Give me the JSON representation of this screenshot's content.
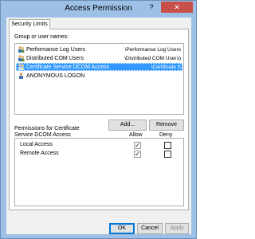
{
  "window": {
    "title": "Access Permission",
    "help_glyph": "?",
    "close_glyph": "✕"
  },
  "tabs": [
    {
      "label": "Security Limits"
    }
  ],
  "group_label": "Group or user names:",
  "users": [
    {
      "name": "Performance Log Users",
      "path": "\\Performance Log Users",
      "selected": false
    },
    {
      "name": "Distributed COM Users",
      "path": "\\Distributed COM Users)",
      "selected": false
    },
    {
      "name": "Certificate Service DCOM Access",
      "path": "\\Certificate S",
      "selected": true
    },
    {
      "name": "ANONYMOUS LOGON",
      "path": "",
      "selected": false
    }
  ],
  "buttons": {
    "add": "Add...",
    "remove": "Remove",
    "ok": "OK",
    "cancel": "Cancel",
    "apply": "Apply"
  },
  "permissions": {
    "header_line1": "Permissions for Certificate",
    "header_line2": "Service DCOM Access",
    "allow_label": "Allow",
    "deny_label": "Deny",
    "check_glyph": "✓",
    "rows": [
      {
        "name": "Local Access",
        "allow": true,
        "deny": false
      },
      {
        "name": "Remote Access",
        "allow": true,
        "deny": false
      }
    ]
  },
  "colors": {
    "title_bar": "#9dc1e6",
    "close_button": "#c7504a",
    "selection": "#3399ff"
  }
}
